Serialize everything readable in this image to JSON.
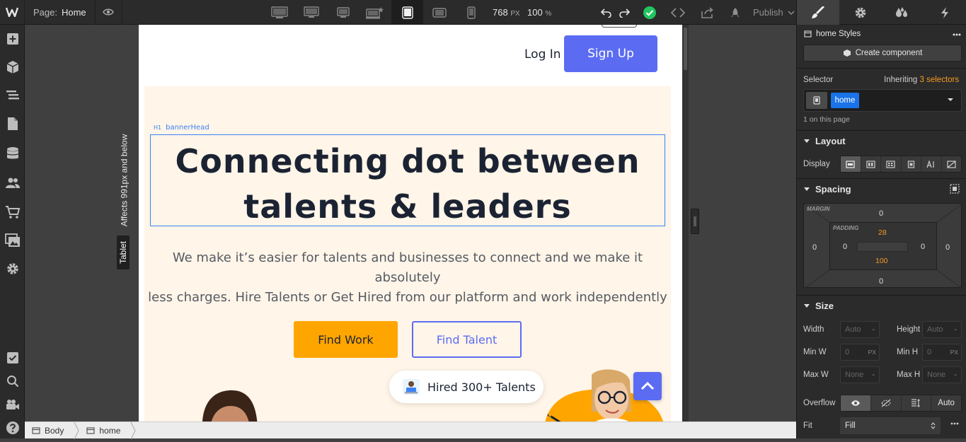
{
  "topbar": {
    "page_prefix": "Page:",
    "page_name": "Home",
    "width_value": "768",
    "width_unit": "PX",
    "zoom_value": "100",
    "zoom_unit": "%",
    "publish_label": "Publish"
  },
  "canvas": {
    "header": {
      "login": "Log In",
      "signup": "Sign Up"
    },
    "selection_tag": "H1",
    "selection_name": "bannerHead",
    "heading_line1": "Connecting dot between",
    "heading_line2": "talents & leaders",
    "description_line1": "We make it’s easier for talents and businesses to connect and we make it absolutely",
    "description_line2": "less charges. Hire Talents or Get Hired from our platform and work independently",
    "find_work": "Find Work",
    "find_talent": "Find Talent",
    "hired_badge": "Hired 300+ Talents",
    "side_note": "Affects 991px and below",
    "side_tag": "Tablet"
  },
  "breadcrumbs": [
    {
      "label": "Body"
    },
    {
      "label": "home"
    }
  ],
  "panel": {
    "styles_title": "home Styles",
    "create_component": "Create component",
    "selector_label": "Selector",
    "inheriting_prefix": "Inheriting",
    "inheriting_count": "3 selectors",
    "selector_chip": "home",
    "on_page": "1 on this page",
    "layout": {
      "title": "Layout",
      "display_label": "Display"
    },
    "spacing": {
      "title": "Spacing",
      "margin_label": "MARGIN",
      "padding_label": "PADDING",
      "margin_top": "0",
      "margin_right": "0",
      "margin_bottom": "0",
      "margin_left": "0",
      "padding_top": "28",
      "padding_right": "0",
      "padding_bottom": "100",
      "padding_left": "0"
    },
    "size": {
      "title": "Size",
      "width_label": "Width",
      "width_value": "Auto",
      "width_unit": "-",
      "height_label": "Height",
      "height_value": "Auto",
      "height_unit": "-",
      "minw_label": "Min W",
      "minw_value": "0",
      "minw_unit": "PX",
      "minh_label": "Min H",
      "minh_value": "0",
      "minh_unit": "PX",
      "maxw_label": "Max W",
      "maxw_value": "None",
      "maxw_unit": "-",
      "maxh_label": "Max H",
      "maxh_value": "None",
      "maxh_unit": "-",
      "overflow_label": "Overflow",
      "overflow_auto": "Auto",
      "fit_label": "Fit",
      "fit_value": "Fill"
    }
  },
  "colors": {
    "accent_blue": "#5b6cf2",
    "orange": "#ffa500",
    "cream": "#fff5e8",
    "heading": "#1b2333",
    "inherit_orange": "#f59a23",
    "chip_blue": "#1a73e8",
    "success": "#22c55e"
  }
}
